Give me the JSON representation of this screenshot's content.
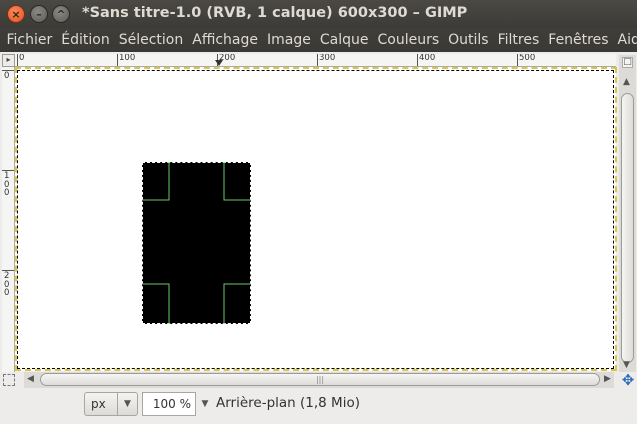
{
  "window": {
    "title": "*Sans titre-1.0 (RVB, 1 calque) 600x300 – GIMP",
    "close_glyph": "×",
    "minimize_glyph": "–",
    "maximize_glyph": "^"
  },
  "menu": [
    "Fichier",
    "Édition",
    "Sélection",
    "Affichage",
    "Image",
    "Calque",
    "Couleurs",
    "Outils",
    "Filtres",
    "Fenêtres",
    "Aide"
  ],
  "rulers": {
    "corner_icon": "ruler-corner-icon",
    "horizontal_labels": [
      "0",
      "100",
      "200",
      "300",
      "400",
      "500"
    ],
    "vertical_labels": [
      "0",
      "100",
      "200"
    ]
  },
  "statusbar": {
    "unit": "px",
    "zoom": "100 %",
    "layer_info": "Arrière-plan (1,8 Mio)"
  },
  "icons": {
    "navigate": "navigate-icon",
    "quick_mask": "quick-mask-icon"
  },
  "colors": {
    "title_bg": "#3c3b37",
    "close_button": "#e25620",
    "canvas_border": "#d8c64a",
    "selection_fill": "#000000",
    "guide_lines": "#66cc66"
  }
}
